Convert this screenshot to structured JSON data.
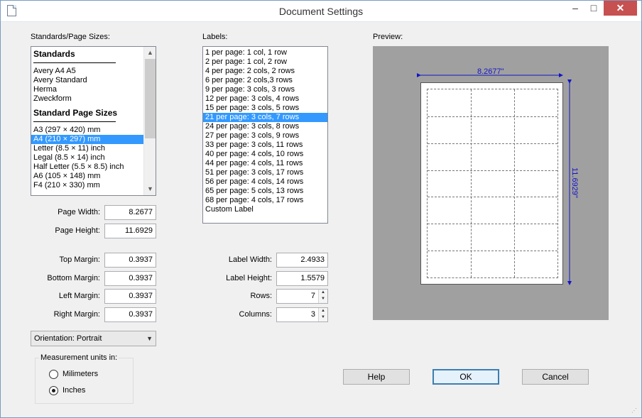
{
  "window": {
    "title": "Document Settings",
    "minimize_icon": "minimize-icon",
    "maximize_icon": "maximize-icon",
    "close_icon": "close-icon"
  },
  "standards": {
    "label": "Standards/Page Sizes:",
    "group1_title": "Standards",
    "group1_items": [
      "Avery A4 A5",
      "Avery Standard",
      "Herma",
      "Zweckform"
    ],
    "group2_title": "Standard Page Sizes",
    "group2_items": [
      "A3 (297 × 420) mm",
      "A4 (210 × 297) mm",
      "Letter (8.5 × 11) inch",
      "Legal (8.5 × 14) inch",
      "Half Letter (5.5 × 8.5) inch",
      "A6 (105 × 148) mm",
      "F4 (210 × 330) mm"
    ],
    "selected": "A4 (210 × 297) mm"
  },
  "labels_list": {
    "label": "Labels:",
    "items": [
      "1 per page: 1 col, 1 row",
      "2 per page: 1 col, 2 row",
      "4 per page: 2 cols, 2 rows",
      "6 per page: 2 cols,3 rows",
      "9 per page: 3 cols, 3 rows",
      "12 per page: 3 cols, 4 rows",
      "15 per page: 3 cols, 5 rows",
      "21 per page: 3 cols, 7 rows",
      "24 per page: 3 cols, 8 rows",
      "27 per page: 3 cols, 9 rows",
      "33 per page: 3 cols, 11 rows",
      "40 per page: 4 cols, 10 rows",
      "44 per page: 4 cols, 11 rows",
      "51 per page: 3 cols, 17 rows",
      "56 per page: 4 cols, 14 rows",
      "65 per page: 5 cols, 13 rows",
      "68 per page: 4 cols, 17 rows",
      "Custom Label"
    ],
    "selected": "21 per page: 3 cols, 7 rows"
  },
  "page_fields": {
    "page_width_label": "Page Width:",
    "page_width": "8.2677",
    "page_height_label": "Page Height:",
    "page_height": "11.6929",
    "top_margin_label": "Top Margin:",
    "top_margin": "0.3937",
    "bottom_margin_label": "Bottom Margin:",
    "bottom_margin": "0.3937",
    "left_margin_label": "Left Margin:",
    "left_margin": "0.3937",
    "right_margin_label": "Right Margin:",
    "right_margin": "0.3937"
  },
  "label_fields": {
    "label_width_label": "Label Width:",
    "label_width": "2.4933",
    "label_height_label": "Label Height:",
    "label_height": "1.5579",
    "rows_label": "Rows:",
    "rows": "7",
    "columns_label": "Columns:",
    "columns": "3"
  },
  "orientation": {
    "value": "Orientation: Portrait"
  },
  "units": {
    "title": "Measurement units in:",
    "options": [
      "Milimeters",
      "Inches"
    ],
    "selected": "Inches"
  },
  "preview": {
    "label": "Preview:",
    "width_text": "8.2677\"",
    "height_text": "11.6929\"",
    "columns": 3,
    "rows": 7,
    "dimension_color": "#1414c8"
  },
  "buttons": {
    "help": "Help",
    "ok": "OK",
    "cancel": "Cancel"
  }
}
